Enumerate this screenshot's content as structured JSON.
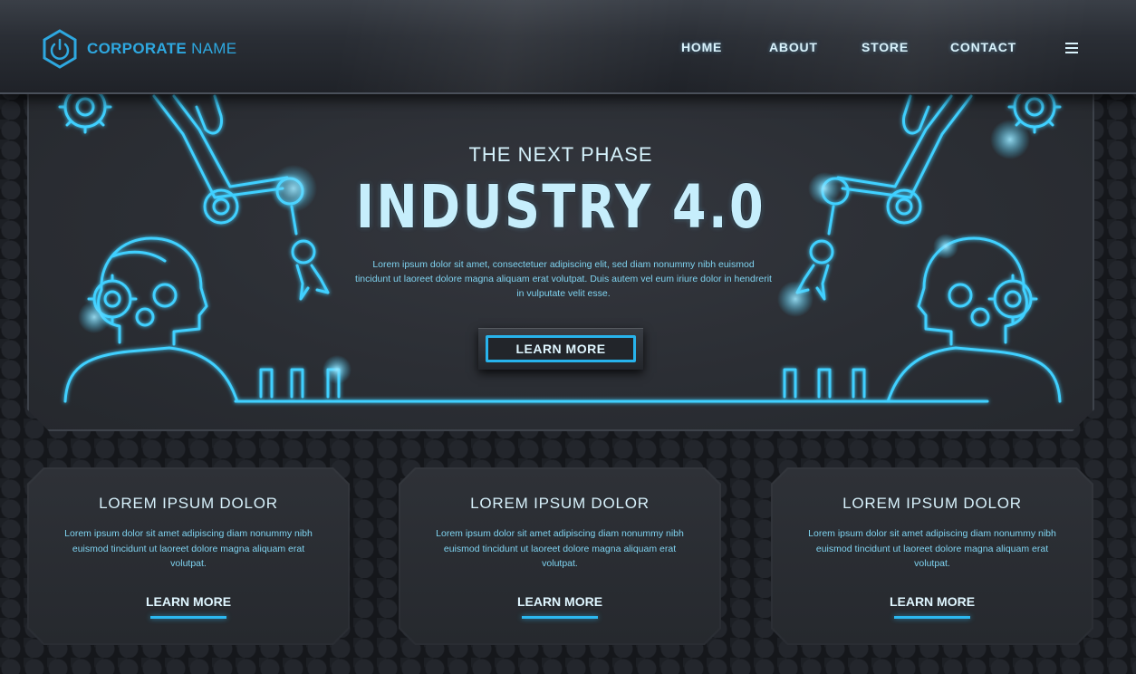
{
  "header": {
    "logo_bold": "CORPORATE",
    "logo_light": "NAME",
    "nav": [
      {
        "label": "HOME"
      },
      {
        "label": "ABOUT"
      },
      {
        "label": "STORE"
      },
      {
        "label": "CONTACT"
      }
    ],
    "menu_icon": "hamburger-menu-icon"
  },
  "hero": {
    "subtitle": "THE NEXT PHASE",
    "title": "INDUSTRY 4.0",
    "body": "Lorem ipsum dolor sit amet, consectetuer adipiscing elit, sed diam nonummy nibh euismod tincidunt ut laoreet dolore magna aliquam erat volutpat. Duis autem vel eum iriure dolor in hendrerit in vulputate velit esse.",
    "button_label": "LEARN MORE"
  },
  "cards": [
    {
      "title": "LOREM IPSUM DOLOR",
      "body": "Lorem ipsum dolor sit amet adipiscing diam nonummy nibh euismod tincidunt ut laoreet dolore magna aliquam erat volutpat.",
      "link": "LEARN MORE"
    },
    {
      "title": "LOREM IPSUM DOLOR",
      "body": "Lorem ipsum dolor sit amet adipiscing diam nonummy nibh euismod tincidunt ut laoreet dolore magna aliquam erat volutpat.",
      "link": "LEARN MORE"
    },
    {
      "title": "LOREM IPSUM DOLOR",
      "body": "Lorem ipsum dolor sit amet adipiscing diam nonummy nibh euismod tincidunt ut laoreet dolore magna aliquam erat volutpat.",
      "link": "LEARN MORE"
    }
  ],
  "colors": {
    "accent": "#27b3ec",
    "neon": "#3fd0ff",
    "background": "#15171b",
    "panel": "#2b2e34"
  }
}
